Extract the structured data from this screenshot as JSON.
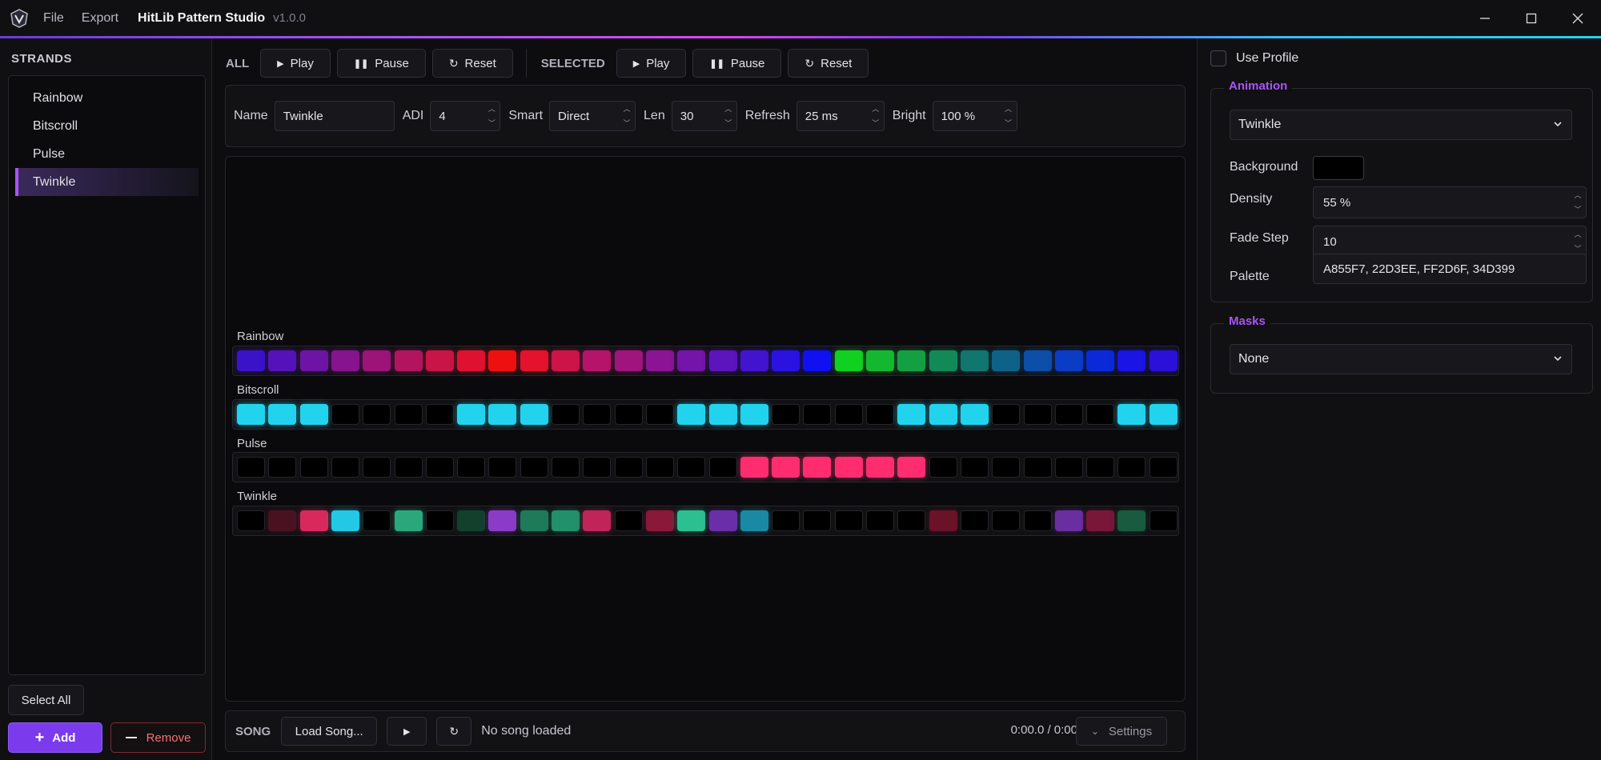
{
  "app": {
    "title": "HitLib Pattern Studio",
    "version": "v1.0.0",
    "menu": [
      "File",
      "Export"
    ]
  },
  "sidebar": {
    "title": "STRANDS",
    "items": [
      {
        "label": "Rainbow",
        "selected": false
      },
      {
        "label": "Bitscroll",
        "selected": false
      },
      {
        "label": "Pulse",
        "selected": false
      },
      {
        "label": "Twinkle",
        "selected": true
      }
    ],
    "select_all_label": "Select All",
    "add_label": "Add",
    "remove_label": "Remove"
  },
  "toolbar": {
    "all_label": "ALL",
    "selected_label": "SELECTED",
    "play_label": "Play",
    "pause_label": "Pause",
    "reset_label": "Reset"
  },
  "props": {
    "name_label": "Name",
    "name_value": "Twinkle",
    "adi_label": "ADI",
    "adi_value": "4",
    "smart_label": "Smart",
    "smart_value": "Direct",
    "len_label": "Len",
    "len_value": "30",
    "refresh_label": "Refresh",
    "refresh_value": "25 ms",
    "bright_label": "Bright",
    "bright_value": "100 %"
  },
  "strips": [
    {
      "label": "Rainbow",
      "leds": [
        "#3a12c8",
        "#5512b8",
        "#6d14a4",
        "#85148e",
        "#9c1478",
        "#b3145f",
        "#c81446",
        "#de1230",
        "#ee1010",
        "#e4122c",
        "#cc1448",
        "#b6146a",
        "#a0147e",
        "#8a1494",
        "#7414a8",
        "#5c14bc",
        "#4214d0",
        "#2a12e0",
        "#1010f0",
        "#10d020",
        "#14b830",
        "#14a042",
        "#128a58",
        "#10766e",
        "#0e6288",
        "#0c4ea8",
        "#0a3cc4",
        "#0a2ad8",
        "#1a14e4",
        "#2a10d8"
      ]
    },
    {
      "label": "Bitscroll",
      "leds": [
        "#22d3ee",
        "#22d3ee",
        "#22d3ee",
        "#000000",
        "#000000",
        "#000000",
        "#000000",
        "#22d3ee",
        "#22d3ee",
        "#22d3ee",
        "#000000",
        "#000000",
        "#000000",
        "#000000",
        "#22d3ee",
        "#22d3ee",
        "#22d3ee",
        "#000000",
        "#000000",
        "#000000",
        "#000000",
        "#22d3ee",
        "#22d3ee",
        "#22d3ee",
        "#000000",
        "#000000",
        "#000000",
        "#000000",
        "#22d3ee",
        "#22d3ee"
      ]
    },
    {
      "label": "Pulse",
      "leds": [
        "#000000",
        "#000000",
        "#000000",
        "#000000",
        "#000000",
        "#000000",
        "#000000",
        "#000000",
        "#000000",
        "#000000",
        "#000000",
        "#000000",
        "#000000",
        "#000000",
        "#000000",
        "#000000",
        "#ff2d6f",
        "#ff2d6f",
        "#ff2d6f",
        "#ff2d6f",
        "#ff2d6f",
        "#ff2d6f",
        "#000000",
        "#000000",
        "#000000",
        "#000000",
        "#000000",
        "#000000",
        "#000000",
        "#000000"
      ]
    },
    {
      "label": "Twinkle",
      "leds": [
        "#000000",
        "#4a1220",
        "#d8285c",
        "#22c8e4",
        "#000000",
        "#2aa87c",
        "#000000",
        "#12402c",
        "#8a3cc8",
        "#1e7a58",
        "#22906a",
        "#c02458",
        "#000000",
        "#8a1838",
        "#2cc090",
        "#6a2ea8",
        "#1a8aa4",
        "#000000",
        "#000000",
        "#000000",
        "#000000",
        "#000000",
        "#6a1228",
        "#000000",
        "#000000",
        "#000000",
        "#6a2ea0",
        "#7a1638",
        "#1a5a3e",
        "#000000"
      ]
    }
  ],
  "song": {
    "label": "SONG",
    "load_label": "Load Song...",
    "status": "No song loaded",
    "time": "0:00.0 / 0:00",
    "settings_label": "Settings"
  },
  "right": {
    "use_profile_label": "Use Profile",
    "animation_title": "Animation",
    "animation_value": "Twinkle",
    "background_label": "Background",
    "background_color": "#000000",
    "density_label": "Density",
    "density_value": "55 %",
    "fade_label": "Fade Step",
    "fade_value": "10",
    "palette_label": "Palette",
    "palette_value": "A855F7, 22D3EE, FF2D6F, 34D399",
    "masks_title": "Masks",
    "masks_value": "None"
  }
}
